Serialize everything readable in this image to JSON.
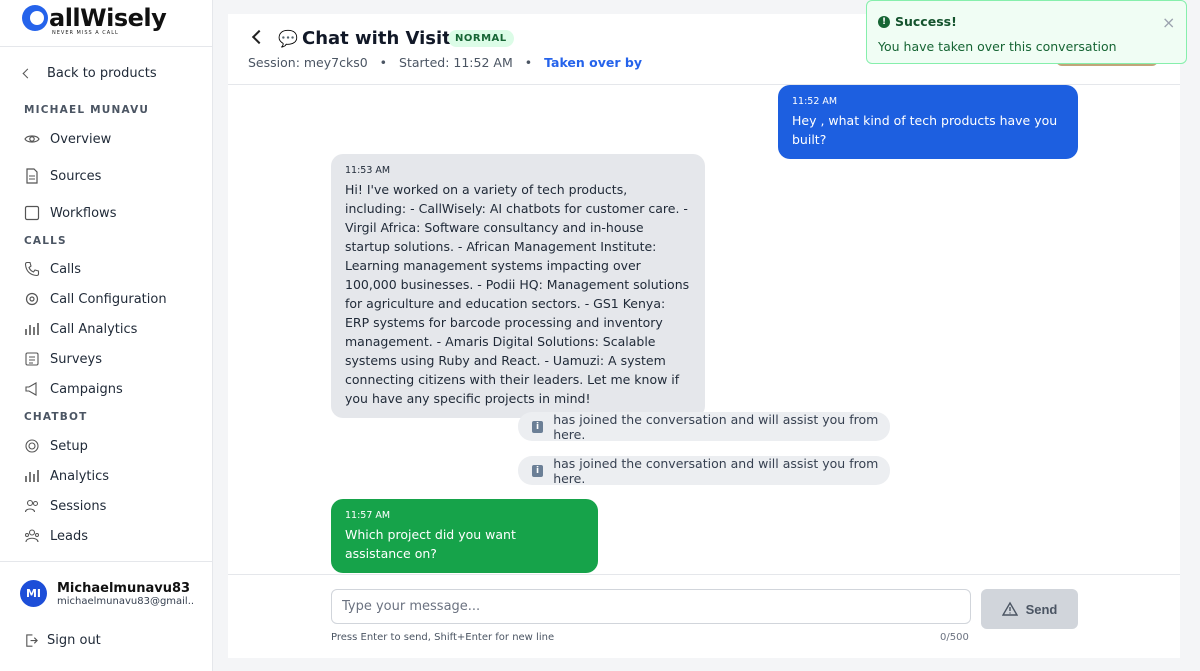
{
  "brand": {
    "name": "allWisely",
    "tagline": "NEVER MISS A CALL"
  },
  "sidebar": {
    "back_label": "Back to products",
    "account_section": "MICHAEL MUNAVU",
    "account_items": [
      {
        "label": "Overview",
        "icon": "eye-icon"
      },
      {
        "label": "Sources",
        "icon": "file-icon"
      },
      {
        "label": "Workflows",
        "icon": "square-icon"
      }
    ],
    "calls_section": "CALLS",
    "calls_items": [
      {
        "label": "Calls",
        "icon": "phone-icon"
      },
      {
        "label": "Call Configuration",
        "icon": "settings-icon"
      },
      {
        "label": "Call Analytics",
        "icon": "bar-chart-icon"
      },
      {
        "label": "Surveys",
        "icon": "list-icon"
      },
      {
        "label": "Campaigns",
        "icon": "megaphone-icon"
      }
    ],
    "chatbot_section": "CHATBOT",
    "chatbot_items": [
      {
        "label": "Setup",
        "icon": "setup-icon"
      },
      {
        "label": "Analytics",
        "icon": "bar-chart-icon"
      },
      {
        "label": "Sessions",
        "icon": "users-icon"
      },
      {
        "label": "Leads",
        "icon": "leads-icon"
      }
    ],
    "user": {
      "initials": "MI",
      "name": "Michaelmunavu83",
      "email": "michaelmunavu83@gmail..."
    },
    "signout_label": "Sign out"
  },
  "header": {
    "title": "Chat with Visitor",
    "badge": "NORMAL",
    "session": "Session: mey7cks0",
    "started": "Started: 11:52 AM",
    "dot": "•",
    "taken": "Taken over by"
  },
  "messages": {
    "user1": {
      "time": "11:52 AM",
      "text": "Hey , what kind of tech products have you built?"
    },
    "bot1": {
      "time": "11:53 AM",
      "text": "Hi! I've worked on a variety of tech products, including: - CallWisely: AI chatbots for customer care. - Virgil Africa: Software consultancy and in-house startup solutions. - African Management Institute: Learning management systems impacting over 100,000 businesses. - Podii HQ: Management solutions for agriculture and education sectors. - GS1 Kenya: ERP systems for barcode processing and inventory management. - Amaris Digital Solutions: Scalable systems using Ruby and React. - Uamuzi: A system connecting citizens with their leaders. Let me know if you have any specific projects in mind!"
    },
    "sys1": "has joined the conversation and will assist you from here.",
    "sys2": "has joined the conversation and will assist you from here.",
    "agent1": {
      "time": "11:57 AM",
      "text": "Which project did you want assistance on?"
    }
  },
  "composer": {
    "placeholder": "Type your message...",
    "send_label": "Send",
    "hint": "Press Enter to send, Shift+Enter for new line",
    "counter": "0/500"
  },
  "toast": {
    "title": "Success!",
    "message": "You have taken over this conversation",
    "close": "×"
  },
  "colors": {
    "accent": "#1d5fe0",
    "agent": "#16a34a",
    "badge_bg": "#dcfce7"
  }
}
